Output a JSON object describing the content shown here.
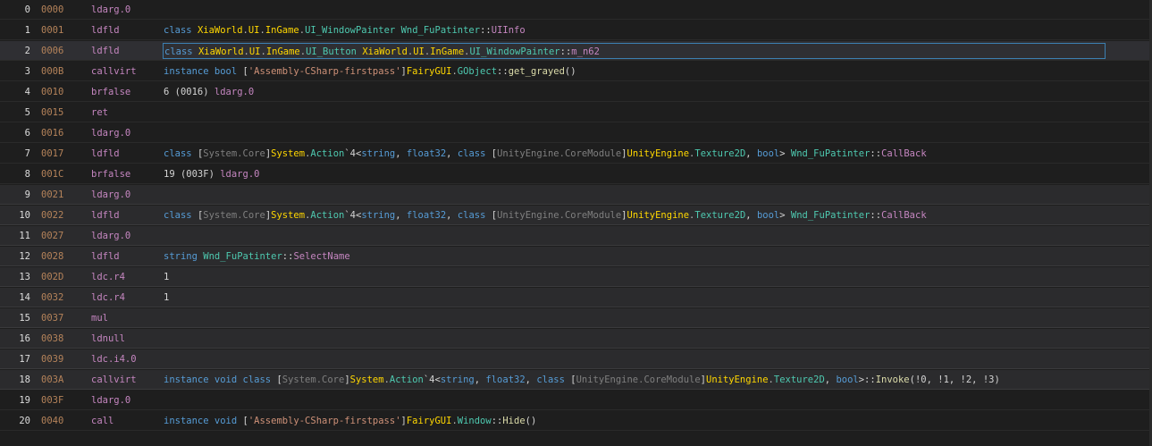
{
  "rows": [
    {
      "index": "0",
      "offset": "0000",
      "opcode": "ldarg.0",
      "operand": []
    },
    {
      "index": "1",
      "offset": "0001",
      "opcode": "ldfld",
      "operand": [
        [
          "kw",
          "class "
        ],
        [
          "nsw",
          "XiaWorld"
        ],
        [
          "dot",
          "."
        ],
        [
          "nsw",
          "UI"
        ],
        [
          "dot",
          "."
        ],
        [
          "nsw",
          "InGame"
        ],
        [
          "dot",
          "."
        ],
        [
          "type",
          "UI_WindowPainter"
        ],
        [
          "plain",
          " "
        ],
        [
          "type",
          "Wnd_FuPatinter"
        ],
        [
          "punc",
          "::"
        ],
        [
          "field",
          "UIInfo"
        ]
      ]
    },
    {
      "index": "2",
      "offset": "0006",
      "opcode": "ldfld",
      "selected": true,
      "operand": [
        [
          "kw",
          "class "
        ],
        [
          "nsw",
          "XiaWorld"
        ],
        [
          "dot",
          "."
        ],
        [
          "nsw",
          "UI"
        ],
        [
          "dot",
          "."
        ],
        [
          "nsw",
          "InGame"
        ],
        [
          "dot",
          "."
        ],
        [
          "type",
          "UI_Button"
        ],
        [
          "plain",
          " "
        ],
        [
          "nsw",
          "XiaWorld"
        ],
        [
          "dot",
          "."
        ],
        [
          "nsw",
          "UI"
        ],
        [
          "dot",
          "."
        ],
        [
          "nsw",
          "InGame"
        ],
        [
          "dot",
          "."
        ],
        [
          "type",
          "UI_WindowPainter"
        ],
        [
          "punc",
          "::"
        ],
        [
          "field",
          "m_n62"
        ]
      ]
    },
    {
      "index": "3",
      "offset": "000B",
      "opcode": "callvirt",
      "operand": [
        [
          "kw",
          "instance bool "
        ],
        [
          "punc",
          "["
        ],
        [
          "asm",
          "'Assembly-CSharp-firstpass'"
        ],
        [
          "punc",
          "]"
        ],
        [
          "nsw",
          "FairyGUI"
        ],
        [
          "dot",
          "."
        ],
        [
          "type",
          "GObject"
        ],
        [
          "punc",
          "::"
        ],
        [
          "meth",
          "get_grayed"
        ],
        [
          "punc",
          "()"
        ]
      ]
    },
    {
      "index": "4",
      "offset": "0010",
      "opcode": "brfalse",
      "operand": [
        [
          "plain",
          "6 (0016) "
        ],
        [
          "op",
          "ldarg.0"
        ]
      ]
    },
    {
      "index": "5",
      "offset": "0015",
      "opcode": "ret",
      "operand": []
    },
    {
      "index": "6",
      "offset": "0016",
      "opcode": "ldarg.0",
      "operand": []
    },
    {
      "index": "7",
      "offset": "0017",
      "opcode": "ldfld",
      "operand": [
        [
          "kw",
          "class "
        ],
        [
          "punc",
          "["
        ],
        [
          "grey",
          "System.Core"
        ],
        [
          "punc",
          "]"
        ],
        [
          "nsw",
          "System"
        ],
        [
          "dot",
          "."
        ],
        [
          "type",
          "Action"
        ],
        [
          "punc",
          "`4<"
        ],
        [
          "kw",
          "string"
        ],
        [
          "punc",
          ", "
        ],
        [
          "kw",
          "float32"
        ],
        [
          "punc",
          ", "
        ],
        [
          "kw",
          "class "
        ],
        [
          "punc",
          "["
        ],
        [
          "grey",
          "UnityEngine.CoreModule"
        ],
        [
          "punc",
          "]"
        ],
        [
          "nsw",
          "UnityEngine"
        ],
        [
          "dot",
          "."
        ],
        [
          "type",
          "Texture2D"
        ],
        [
          "punc",
          ", "
        ],
        [
          "kw",
          "bool"
        ],
        [
          "punc",
          "> "
        ],
        [
          "type",
          "Wnd_FuPatinter"
        ],
        [
          "punc",
          "::"
        ],
        [
          "field",
          "CallBack"
        ]
      ]
    },
    {
      "index": "8",
      "offset": "001C",
      "opcode": "brfalse",
      "operand": [
        [
          "plain",
          "19 (003F) "
        ],
        [
          "op",
          "ldarg.0"
        ]
      ]
    },
    {
      "index": "9",
      "offset": "0021",
      "opcode": "ldarg.0",
      "alt": true,
      "operand": []
    },
    {
      "index": "10",
      "offset": "0022",
      "opcode": "ldfld",
      "alt": true,
      "operand": [
        [
          "kw",
          "class "
        ],
        [
          "punc",
          "["
        ],
        [
          "grey",
          "System.Core"
        ],
        [
          "punc",
          "]"
        ],
        [
          "nsw",
          "System"
        ],
        [
          "dot",
          "."
        ],
        [
          "type",
          "Action"
        ],
        [
          "punc",
          "`4<"
        ],
        [
          "kw",
          "string"
        ],
        [
          "punc",
          ", "
        ],
        [
          "kw",
          "float32"
        ],
        [
          "punc",
          ", "
        ],
        [
          "kw",
          "class "
        ],
        [
          "punc",
          "["
        ],
        [
          "grey",
          "UnityEngine.CoreModule"
        ],
        [
          "punc",
          "]"
        ],
        [
          "nsw",
          "UnityEngine"
        ],
        [
          "dot",
          "."
        ],
        [
          "type",
          "Texture2D"
        ],
        [
          "punc",
          ", "
        ],
        [
          "kw",
          "bool"
        ],
        [
          "punc",
          "> "
        ],
        [
          "type",
          "Wnd_FuPatinter"
        ],
        [
          "punc",
          "::"
        ],
        [
          "field",
          "CallBack"
        ]
      ]
    },
    {
      "index": "11",
      "offset": "0027",
      "opcode": "ldarg.0",
      "alt": true,
      "operand": []
    },
    {
      "index": "12",
      "offset": "0028",
      "opcode": "ldfld",
      "alt": true,
      "operand": [
        [
          "kw",
          "string "
        ],
        [
          "type",
          "Wnd_FuPatinter"
        ],
        [
          "punc",
          "::"
        ],
        [
          "field",
          "SelectName"
        ]
      ]
    },
    {
      "index": "13",
      "offset": "002D",
      "opcode": "ldc.r4",
      "alt": true,
      "operand": [
        [
          "plain",
          "1"
        ]
      ]
    },
    {
      "index": "14",
      "offset": "0032",
      "opcode": "ldc.r4",
      "alt": true,
      "operand": [
        [
          "plain",
          "1"
        ]
      ]
    },
    {
      "index": "15",
      "offset": "0037",
      "opcode": "mul",
      "alt": true,
      "operand": []
    },
    {
      "index": "16",
      "offset": "0038",
      "opcode": "ldnull",
      "alt": true,
      "operand": []
    },
    {
      "index": "17",
      "offset": "0039",
      "opcode": "ldc.i4.0",
      "alt": true,
      "operand": []
    },
    {
      "index": "18",
      "offset": "003A",
      "opcode": "callvirt",
      "alt": true,
      "operand": [
        [
          "kw",
          "instance void class "
        ],
        [
          "punc",
          "["
        ],
        [
          "grey",
          "System.Core"
        ],
        [
          "punc",
          "]"
        ],
        [
          "nsw",
          "System"
        ],
        [
          "dot",
          "."
        ],
        [
          "type",
          "Action"
        ],
        [
          "punc",
          "`4<"
        ],
        [
          "kw",
          "string"
        ],
        [
          "punc",
          ", "
        ],
        [
          "kw",
          "float32"
        ],
        [
          "punc",
          ", "
        ],
        [
          "kw",
          "class "
        ],
        [
          "punc",
          "["
        ],
        [
          "grey",
          "UnityEngine.CoreModule"
        ],
        [
          "punc",
          "]"
        ],
        [
          "nsw",
          "UnityEngine"
        ],
        [
          "dot",
          "."
        ],
        [
          "type",
          "Texture2D"
        ],
        [
          "punc",
          ", "
        ],
        [
          "kw",
          "bool"
        ],
        [
          "punc",
          ">::"
        ],
        [
          "meth",
          "Invoke"
        ],
        [
          "punc",
          "(!0, !1, !2, !3)"
        ]
      ]
    },
    {
      "index": "19",
      "offset": "003F",
      "opcode": "ldarg.0",
      "operand": []
    },
    {
      "index": "20",
      "offset": "0040",
      "opcode": "call",
      "operand": [
        [
          "kw",
          "instance void "
        ],
        [
          "punc",
          "["
        ],
        [
          "asm",
          "'Assembly-CSharp-firstpass'"
        ],
        [
          "punc",
          "]"
        ],
        [
          "nsw",
          "FairyGUI"
        ],
        [
          "dot",
          "."
        ],
        [
          "type",
          "Window"
        ],
        [
          "punc",
          "::"
        ],
        [
          "meth",
          "Hide"
        ],
        [
          "punc",
          "()"
        ]
      ]
    }
  ]
}
